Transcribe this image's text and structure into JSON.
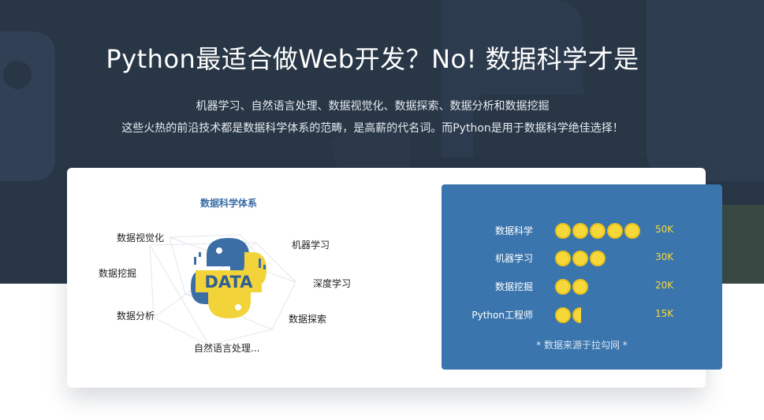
{
  "hero": {
    "title": "Python最适合做Web开发？No! 数据科学才是",
    "subtitle_line1": "机器学习、自然语言处理、数据视觉化、数据探索、数据分析和数据挖掘",
    "subtitle_line2": "这些火热的前沿技术都是数据科学体系的范畴，是高薪的代名词。而Python是用于数据科学绝佳选择！"
  },
  "diagram": {
    "title": "数据科学体系",
    "logo_text": "DATA",
    "nodes": {
      "visualization": "数据视觉化",
      "machine_learning": "机器学习",
      "mining": "数据挖掘",
      "deep_learning": "深度学习",
      "analysis": "数据分析",
      "exploration": "数据探索",
      "nlp": "自然语言处理..."
    }
  },
  "stats": {
    "rows": [
      {
        "label": "数据科学",
        "coins": 5,
        "value": "50K"
      },
      {
        "label": "机器学习",
        "coins": 3,
        "value": "30K"
      },
      {
        "label": "数据挖掘",
        "coins": 2,
        "value": "20K"
      },
      {
        "label": "Python工程师",
        "coins": 1.5,
        "value": "15K"
      }
    ],
    "footnote": "* 数据来源于拉勾网 *"
  },
  "colors": {
    "hero_bg": "#283646",
    "stats_bg": "#3a75ad",
    "coin": "#f7d83a",
    "accent_title": "#3b6ea5"
  }
}
